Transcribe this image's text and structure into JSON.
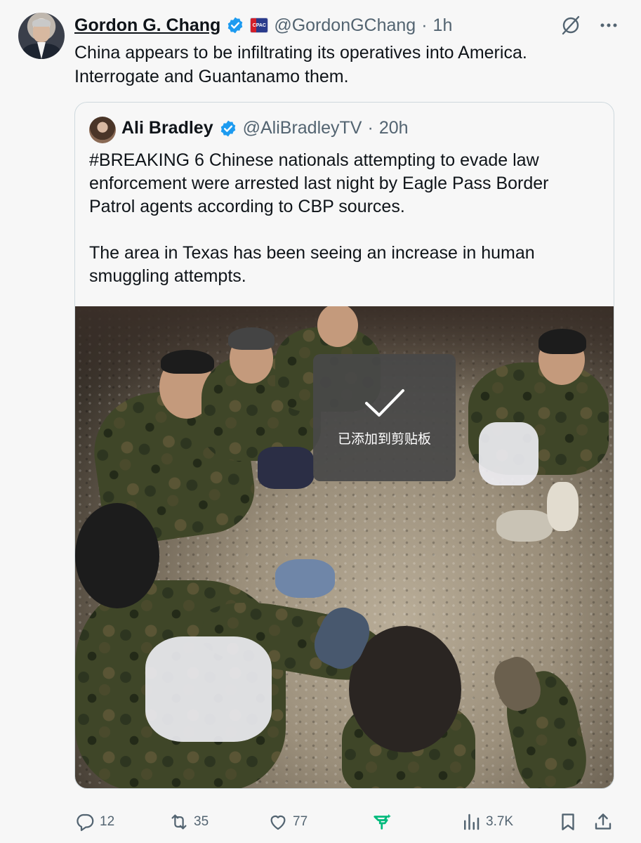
{
  "tweet": {
    "author": {
      "name": "Gordon G. Chang",
      "handle": "@GordonGChang",
      "time": "1h",
      "badge_text": "CPAC"
    },
    "separator": "·",
    "text": "China appears to be infiltrating its operatives into America. Interrogate and Guantanamo them.",
    "quoted": {
      "author": {
        "name": "Ali Bradley",
        "handle": "@AliBradleyTV",
        "time": "20h"
      },
      "text": "#BREAKING 6 Chinese nationals attempting to evade law enforcement were arrested last night by Eagle Pass Border Patrol agents according to CBP sources.\n\nThe area in Texas has been seeing an increase in human smuggling attempts.",
      "toast": {
        "text": "已添加到剪贴板",
        "icon": "checkmark-icon"
      }
    },
    "stats": {
      "replies": "12",
      "reposts": "35",
      "likes": "77",
      "views": "3.7K"
    }
  },
  "colors": {
    "background": "#f7f7f7",
    "verified": "#1d9bf0",
    "secondary_text": "#536471",
    "grok_accent": "#00ba7c",
    "toast_bg": "#484848"
  }
}
